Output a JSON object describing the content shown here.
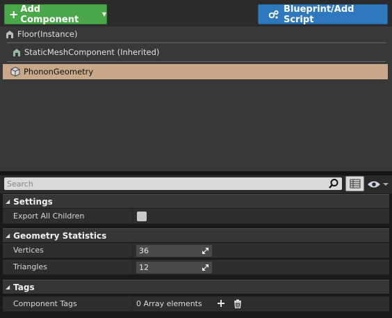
{
  "toolbar": {
    "add_component_label": "Add Component",
    "blueprint_label": "Blueprint/Add Script"
  },
  "tree": [
    {
      "label": "Floor(Instance)",
      "icon": "actor-icon"
    },
    {
      "label": "StaticMeshComponent (Inherited)",
      "icon": "static-mesh-icon"
    },
    {
      "label": "PhononGeometry",
      "icon": "cube-icon",
      "selected": true
    }
  ],
  "search": {
    "placeholder": "Search"
  },
  "categories": {
    "settings": {
      "title": "Settings",
      "props": [
        {
          "name": "Export All Children",
          "value": false
        }
      ]
    },
    "geometry": {
      "title": "Geometry Statistics",
      "props": [
        {
          "name": "Vertices",
          "value": "36"
        },
        {
          "name": "Triangles",
          "value": "12"
        }
      ]
    },
    "tags": {
      "title": "Tags",
      "props": [
        {
          "name": "Component Tags",
          "value": "0 Array elements"
        }
      ]
    }
  },
  "colors": {
    "add_button": "#4aa84a",
    "blueprint_button": "#2e79bd",
    "selected_row": "#c8a888"
  }
}
